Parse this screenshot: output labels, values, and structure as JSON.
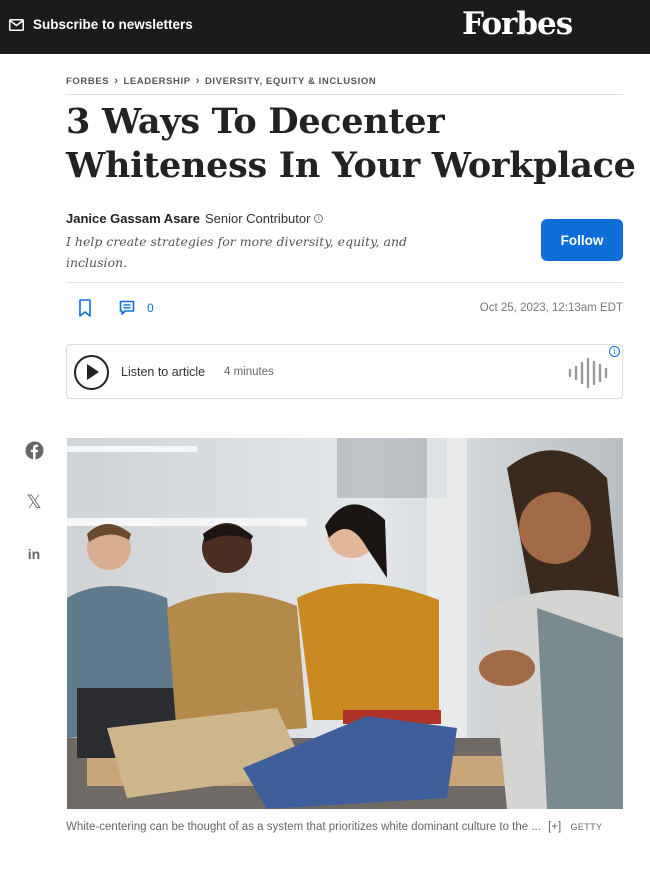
{
  "header": {
    "subscribe_label": "Subscribe to newsletters",
    "brand": "Forbes"
  },
  "breadcrumb": [
    "FORBES",
    "LEADERSHIP",
    "DIVERSITY, EQUITY & INCLUSION"
  ],
  "article": {
    "title": "3 Ways To Decenter Whiteness In Your Workplace",
    "author": "Janice Gassam Asare",
    "author_role": "Senior Contributor",
    "bio": "I help create strategies for more diversity, equity, and inclusion.",
    "follow_label": "Follow",
    "comment_count": "0",
    "date": "Oct 25, 2023, 12:13am EDT"
  },
  "audio": {
    "listen_label": "Listen to article",
    "duration": "4 minutes"
  },
  "image": {
    "caption": "White-centering can be thought of as a system that prioritizes white dominant culture to the ...",
    "expand_label": "[+]",
    "credit": "GETTY"
  },
  "icons": {
    "mail": "mail-icon",
    "info": "info-icon",
    "bookmark": "bookmark-icon",
    "comment": "comment-icon",
    "play": "play-icon",
    "waveform": "waveform-icon",
    "facebook": "facebook-icon",
    "x": "x-icon",
    "linkedin": "linkedin-icon"
  },
  "colors": {
    "accent": "#0e6ed8",
    "header_bg": "#1b1b1b"
  }
}
